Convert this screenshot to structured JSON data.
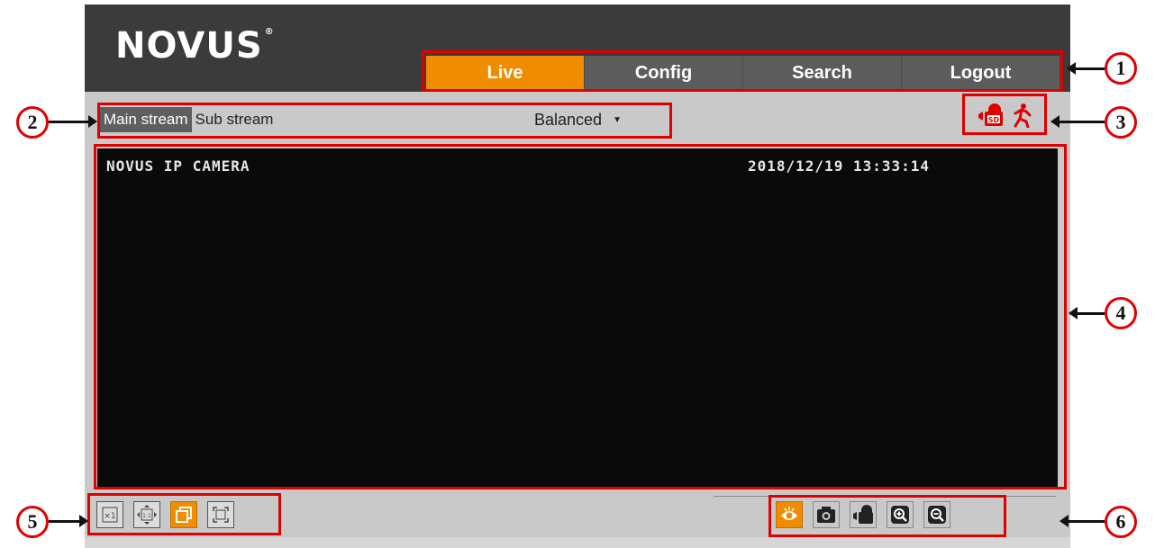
{
  "app": {
    "logo": "NOVUS",
    "logo_mark": "®"
  },
  "nav": {
    "tabs": [
      {
        "label": "Live",
        "active": true
      },
      {
        "label": "Config",
        "active": false
      },
      {
        "label": "Search",
        "active": false
      },
      {
        "label": "Logout",
        "active": false
      }
    ]
  },
  "stream": {
    "main": "Main stream",
    "sub": "Sub stream",
    "selected": "Main stream",
    "quality": "Balanced"
  },
  "status_icons": [
    "sd-card-record-icon",
    "motion-detection-icon"
  ],
  "video": {
    "osd_title": "NOVUS IP CAMERA",
    "osd_time": "2018/12/19 13:33:14"
  },
  "view_controls": [
    "original-size-icon",
    "fit-aspect-icon",
    "window-mode-icon",
    "fullscreen-icon"
  ],
  "stream_controls": [
    "live-view-icon",
    "snapshot-icon",
    "record-icon",
    "zoom-in-icon",
    "zoom-out-icon"
  ],
  "colors": {
    "accent": "#f08c00",
    "annotation": "#e00000",
    "header": "#3b3b3b",
    "panel": "#c9c9c9"
  },
  "annotations": {
    "labels": [
      "1",
      "2",
      "3",
      "4",
      "5",
      "6"
    ]
  }
}
